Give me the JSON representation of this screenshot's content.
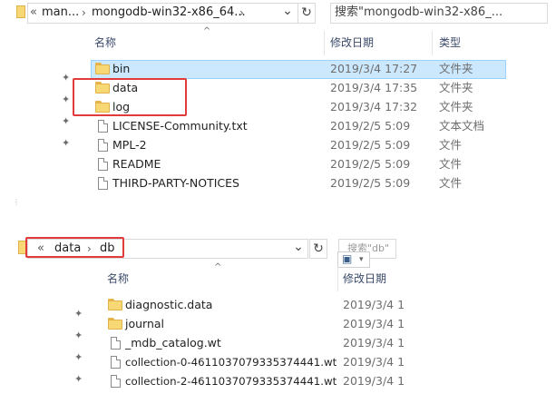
{
  "top": {
    "address": {
      "back_chevron": "«",
      "crumb1": "man...",
      "sep1": "›",
      "crumb2": "mongodb-win32-x86_64...",
      "sep2": "›",
      "dropdown": "⌄",
      "refresh": "↻"
    },
    "search_placeholder": "搜索\"mongodb-win32-x86_...",
    "columns": {
      "name": "名称",
      "date": "修改日期",
      "type": "类型"
    },
    "sort_indicator": "^",
    "rows": [
      {
        "name": "bin",
        "date": "2019/3/4 17:27",
        "type": "文件夹",
        "icon": "folder-icon"
      },
      {
        "name": "data",
        "date": "2019/3/4 17:35",
        "type": "文件夹",
        "icon": "folder-icon"
      },
      {
        "name": "log",
        "date": "2019/3/4 17:32",
        "type": "文件夹",
        "icon": "folder-icon"
      },
      {
        "name": "LICENSE-Community.txt",
        "date": "2019/2/5 5:09",
        "type": "文本文档",
        "icon": "text-file-icon"
      },
      {
        "name": "MPL-2",
        "date": "2019/2/5 5:09",
        "type": "文件",
        "icon": "file-icon"
      },
      {
        "name": "README",
        "date": "2019/2/5 5:09",
        "type": "文件",
        "icon": "file-icon"
      },
      {
        "name": "THIRD-PARTY-NOTICES",
        "date": "2019/2/5 5:09",
        "type": "文件",
        "icon": "file-icon"
      }
    ]
  },
  "bottom": {
    "address": {
      "back_chevron": "«",
      "crumb1": "data",
      "sep1": "›",
      "crumb2": "db",
      "dropdown": "⌄",
      "refresh": "↻"
    },
    "search_placeholder": "搜索\"db\"",
    "columns": {
      "name": "名称",
      "date": "修改日期"
    },
    "sort_indicator": "^",
    "rows": [
      {
        "name": "diagnostic.data",
        "date": "2019/3/4 1",
        "icon": "folder-icon"
      },
      {
        "name": "journal",
        "date": "2019/3/4 1",
        "icon": "folder-icon"
      },
      {
        "name": "_mdb_catalog.wt",
        "date": "2019/3/4 1",
        "icon": "file-icon"
      },
      {
        "name": "collection-0-4611037079335374441.wt",
        "date": "2019/3/4 1",
        "icon": "file-icon"
      },
      {
        "name": "collection-2-4611037079335374441.wt",
        "date": "2019/3/4 1",
        "icon": "file-icon"
      }
    ]
  },
  "colors": {
    "highlight_red": "#e23b3b",
    "selection_bg": "#cce8ff",
    "folder_yellow": "#f8d775"
  }
}
